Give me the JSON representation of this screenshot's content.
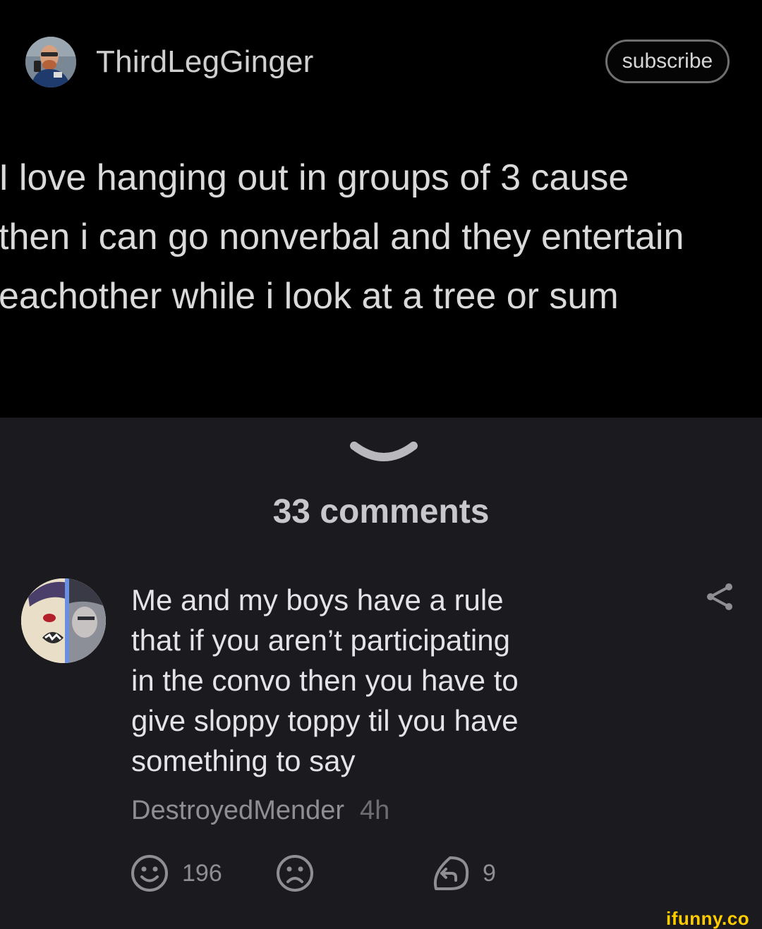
{
  "post": {
    "username": "ThirdLegGinger",
    "subscribe_label": "subscribe",
    "text_lines": [
      "I love hanging out in groups of 3 cause",
      "then i can go nonverbal and they entertain",
      "eachother while i look at a tree or sum"
    ]
  },
  "comments_header": {
    "count_label": "33 comments"
  },
  "comment": {
    "text_lines": [
      "Me and my boys have a rule",
      "that if you aren’t participating",
      "in the convo then you have to",
      "give sloppy toppy til you have",
      "something to say"
    ],
    "author": "DestroyedMender",
    "time": "4h",
    "likes": "196",
    "replies": "9"
  },
  "icons": {
    "chevron": "chevron-down-icon",
    "share": "share-icon",
    "like": "smile-icon",
    "dislike": "frown-icon",
    "reply": "reply-icon"
  },
  "watermark": "ifunny.co",
  "colors": {
    "post_background": "#000000",
    "comments_background": "#1b1b1f",
    "watermark": "#ffcc00"
  }
}
